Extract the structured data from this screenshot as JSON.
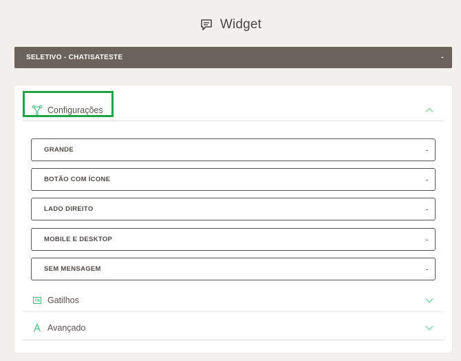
{
  "header": {
    "title": "Widget",
    "icon": "chat-bubble-icon"
  },
  "channel_select": {
    "value": "SELETIVO - CHATISATESTE",
    "caret": "-"
  },
  "sections": {
    "config": {
      "label": "Configurações",
      "icon": "vector-nodes-icon",
      "state": "expanded"
    },
    "gatilhos": {
      "label": "Gatilhos",
      "icon": "trigger-box-icon",
      "state": "collapsed"
    },
    "avancado": {
      "label": "Avançado",
      "icon": "letter-a-icon",
      "state": "collapsed"
    }
  },
  "options": [
    {
      "label": "GRANDE",
      "caret": "-"
    },
    {
      "label": "BOTÃO COM ÍCONE",
      "caret": "-"
    },
    {
      "label": "LADO DIREITO",
      "caret": "-"
    },
    {
      "label": "MOBILE E DESKTOP",
      "caret": "-"
    },
    {
      "label": "SEM MENSAGEM",
      "caret": "-"
    }
  ],
  "colors": {
    "background": "#f2f0ed",
    "select_bar": "#6b635b",
    "accent_green": "#3dbd7d",
    "highlight": "#23a347"
  }
}
